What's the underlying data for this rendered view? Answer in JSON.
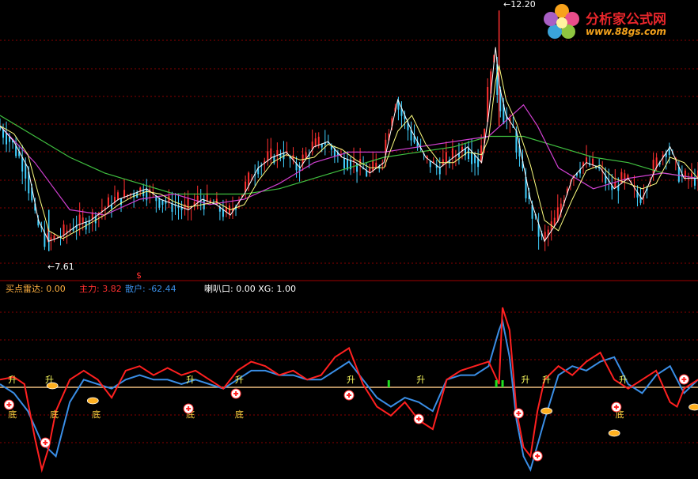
{
  "watermark": {
    "site_name": "分析家公式网",
    "url": "www.88gs.com"
  },
  "price_panel": {
    "high_label": "12.20",
    "low_label": "7.61",
    "high_prefix": "←",
    "low_prefix": "←"
  },
  "indicator_legend": {
    "buy_radar_label": "买点雷达:",
    "buy_radar_value": "0.00",
    "main_force_label": "主力:",
    "main_force_value": "3.82",
    "retail_label": "散户:",
    "retail_value": "-62.44",
    "trumpet_label": "喇叭口:",
    "trumpet_value": "0.00",
    "xg_label": "XG:",
    "xg_value": "1.00"
  },
  "colors": {
    "main_force": "#ff2020",
    "retail": "#3a8ee6",
    "zero_line": "#f0c080",
    "ma_white": "#ffffff",
    "ma_yellow": "#ffff80",
    "ma_magenta": "#d040d0",
    "ma_green": "#40c040",
    "candle_up": "#ff3030",
    "candle_down": "#40d0ff",
    "grid": "#8a0000",
    "sep": "#a00000"
  },
  "markers": {
    "rise": "升",
    "bottom": "底",
    "buy_sign": "$"
  },
  "chart_data": [
    {
      "type": "line",
      "title": "",
      "panel": "price",
      "ylim": [
        7.2,
        12.4
      ],
      "annotations": [
        {
          "text": "12.20",
          "x": 0.715,
          "y": 12.2
        },
        {
          "text": "7.61",
          "x": 0.07,
          "y": 7.61
        }
      ],
      "series": [
        {
          "role": "close",
          "x": [
            0,
            0.02,
            0.04,
            0.055,
            0.07,
            0.09,
            0.11,
            0.13,
            0.15,
            0.17,
            0.19,
            0.21,
            0.23,
            0.25,
            0.27,
            0.29,
            0.31,
            0.33,
            0.35,
            0.37,
            0.39,
            0.41,
            0.43,
            0.45,
            0.47,
            0.49,
            0.51,
            0.53,
            0.55,
            0.57,
            0.59,
            0.61,
            0.63,
            0.65,
            0.67,
            0.69,
            0.7,
            0.71,
            0.715,
            0.725,
            0.74,
            0.76,
            0.78,
            0.8,
            0.82,
            0.84,
            0.86,
            0.88,
            0.9,
            0.92,
            0.94,
            0.96,
            0.98,
            1.0
          ],
          "values": [
            10.0,
            9.7,
            9.2,
            8.2,
            7.8,
            7.9,
            8.1,
            8.2,
            8.4,
            8.6,
            8.7,
            8.8,
            8.6,
            8.5,
            8.4,
            8.6,
            8.5,
            8.3,
            8.7,
            9.2,
            9.4,
            9.5,
            9.2,
            9.6,
            9.7,
            9.4,
            9.3,
            9.1,
            9.3,
            10.5,
            9.9,
            9.4,
            9.2,
            9.4,
            9.6,
            9.3,
            10.2,
            11.5,
            10.8,
            10.2,
            9.9,
            8.6,
            7.8,
            8.2,
            9.0,
            9.3,
            9.2,
            8.8,
            9.0,
            8.6,
            9.2,
            9.6,
            9.0,
            9.0
          ]
        },
        {
          "role": "ma-long",
          "x": [
            0,
            0.05,
            0.1,
            0.15,
            0.2,
            0.25,
            0.3,
            0.35,
            0.4,
            0.45,
            0.5,
            0.55,
            0.6,
            0.65,
            0.7,
            0.75,
            0.8,
            0.85,
            0.9,
            0.95,
            1.0
          ],
          "values": [
            10.2,
            9.8,
            9.4,
            9.1,
            8.9,
            8.7,
            8.7,
            8.7,
            8.8,
            9.0,
            9.2,
            9.4,
            9.5,
            9.6,
            9.8,
            9.8,
            9.6,
            9.4,
            9.3,
            9.1,
            9.0
          ]
        },
        {
          "role": "ma-mid",
          "x": [
            0,
            0.05,
            0.1,
            0.15,
            0.2,
            0.25,
            0.3,
            0.35,
            0.4,
            0.45,
            0.5,
            0.55,
            0.6,
            0.65,
            0.7,
            0.75,
            0.77,
            0.8,
            0.85,
            0.9,
            0.95,
            1.0
          ],
          "values": [
            10.0,
            9.3,
            8.4,
            8.3,
            8.6,
            8.7,
            8.5,
            8.6,
            8.9,
            9.3,
            9.5,
            9.5,
            9.6,
            9.7,
            9.8,
            10.4,
            10.0,
            9.2,
            8.8,
            9.0,
            9.1,
            9.0
          ]
        }
      ]
    },
    {
      "type": "line",
      "title": "",
      "panel": "indicator",
      "ylim": [
        -100,
        100
      ],
      "series": [
        {
          "role": "main-force",
          "x": [
            0,
            0.02,
            0.035,
            0.05,
            0.06,
            0.07,
            0.08,
            0.1,
            0.12,
            0.14,
            0.16,
            0.18,
            0.2,
            0.22,
            0.24,
            0.26,
            0.28,
            0.3,
            0.32,
            0.34,
            0.36,
            0.38,
            0.4,
            0.42,
            0.44,
            0.46,
            0.48,
            0.5,
            0.52,
            0.54,
            0.56,
            0.58,
            0.6,
            0.62,
            0.64,
            0.66,
            0.68,
            0.7,
            0.715,
            0.72,
            0.73,
            0.74,
            0.75,
            0.76,
            0.77,
            0.78,
            0.8,
            0.82,
            0.84,
            0.86,
            0.88,
            0.9,
            0.92,
            0.94,
            0.96,
            0.97,
            0.98,
            1.0
          ],
          "values": [
            5,
            8,
            0,
            -60,
            -95,
            -70,
            -30,
            5,
            15,
            5,
            -15,
            15,
            20,
            10,
            18,
            10,
            15,
            5,
            -5,
            15,
            25,
            20,
            10,
            15,
            5,
            10,
            30,
            40,
            0,
            -25,
            -35,
            -20,
            -40,
            -50,
            5,
            15,
            20,
            25,
            0,
            85,
            60,
            -30,
            -70,
            -80,
            -30,
            5,
            20,
            10,
            25,
            35,
            5,
            -5,
            5,
            15,
            -20,
            -25,
            -5,
            5
          ]
        },
        {
          "role": "retail",
          "x": [
            0,
            0.02,
            0.04,
            0.06,
            0.08,
            0.1,
            0.12,
            0.14,
            0.16,
            0.18,
            0.2,
            0.22,
            0.24,
            0.26,
            0.28,
            0.3,
            0.32,
            0.34,
            0.36,
            0.38,
            0.4,
            0.42,
            0.44,
            0.46,
            0.48,
            0.5,
            0.52,
            0.54,
            0.56,
            0.58,
            0.6,
            0.62,
            0.64,
            0.66,
            0.68,
            0.7,
            0.715,
            0.72,
            0.73,
            0.74,
            0.75,
            0.76,
            0.78,
            0.8,
            0.82,
            0.84,
            0.86,
            0.88,
            0.9,
            0.92,
            0.94,
            0.96,
            0.98,
            1.0
          ],
          "values": [
            0,
            -10,
            -30,
            -65,
            -80,
            -20,
            5,
            0,
            -5,
            5,
            10,
            5,
            5,
            0,
            5,
            0,
            -5,
            5,
            15,
            15,
            10,
            10,
            5,
            5,
            15,
            25,
            5,
            -15,
            -25,
            -15,
            -20,
            -30,
            5,
            10,
            10,
            20,
            60,
            70,
            30,
            -40,
            -80,
            -95,
            -40,
            10,
            20,
            15,
            25,
            30,
            0,
            -10,
            10,
            20,
            -10,
            5
          ]
        }
      ]
    }
  ]
}
